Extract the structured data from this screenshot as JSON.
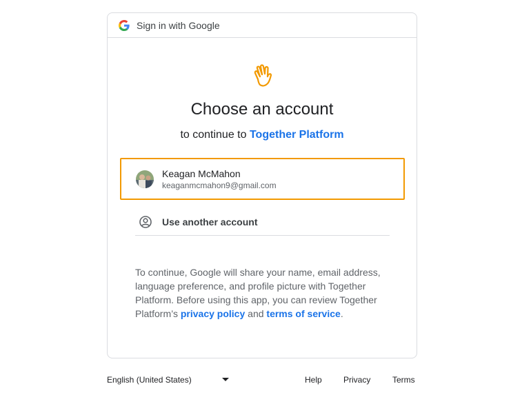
{
  "header": {
    "text": "Sign in with Google"
  },
  "title": "Choose an account",
  "subtitle": {
    "prefix": "to continue to ",
    "app_name": "Together Platform"
  },
  "account": {
    "name": "Keagan McMahon",
    "email": "keaganmcmahon9@gmail.com"
  },
  "another_account": {
    "label": "Use another account"
  },
  "disclaimer": {
    "text": "To continue, Google will share your name, email address, language preference, and profile picture with Together Platform. Before using this app, you can review Together Platform’s ",
    "privacy_link": "privacy policy",
    "conjunction": " and ",
    "terms_link": "terms of service",
    "end": "."
  },
  "footer": {
    "language": "English (United States)",
    "help": "Help",
    "privacy": "Privacy",
    "terms": "Terms"
  },
  "colors": {
    "accent": "#1a73e8",
    "highlight": "#f29900",
    "app_icon": "#f29900"
  }
}
